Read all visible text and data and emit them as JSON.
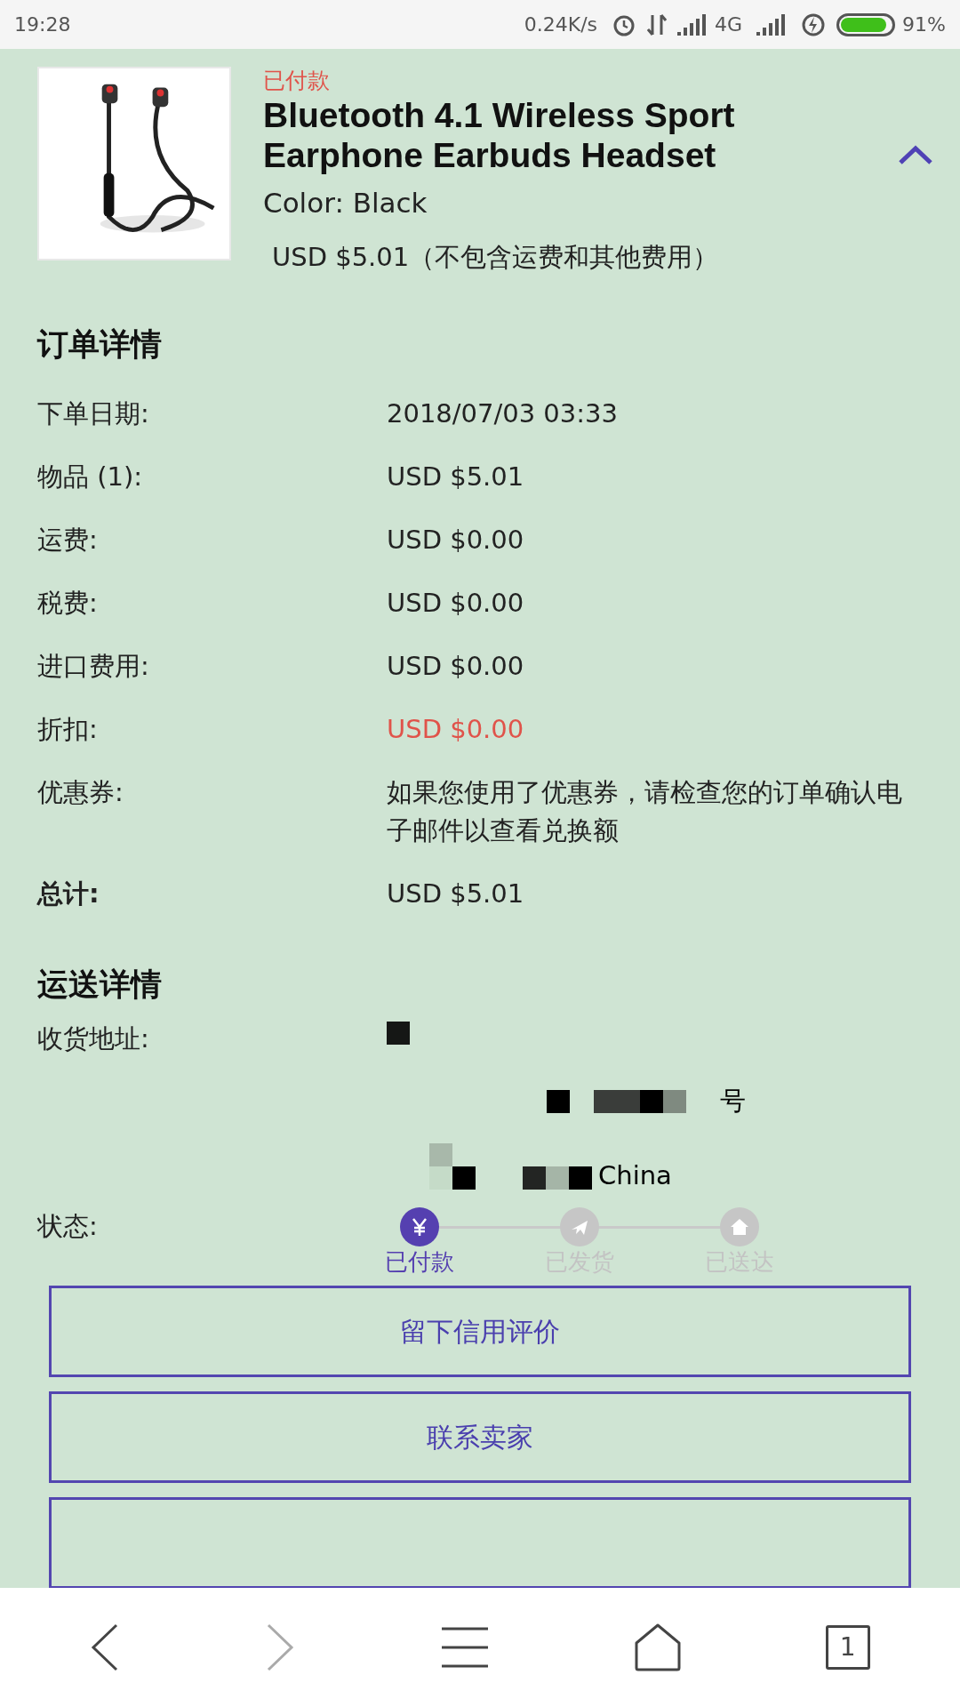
{
  "status_bar": {
    "time": "19:28",
    "speed": "0.24K/s",
    "network": "4G",
    "battery": "91%"
  },
  "item": {
    "status": "已付款",
    "title": "Bluetooth 4.1 Wireless Sport Earphone Earbuds Headset",
    "variant": "Color: Black",
    "price": "USD $5.01（不包含运费和其他费用）",
    "expanded": true
  },
  "order_details": {
    "heading": "订单详情",
    "rows": [
      {
        "label": "下单日期:",
        "value": "2018/07/03 03:33",
        "kind": "plain"
      },
      {
        "label": "物品 (1):",
        "value": "USD $5.01",
        "kind": "plain"
      },
      {
        "label": "运费:",
        "value": "USD $0.00",
        "kind": "plain"
      },
      {
        "label": "税费:",
        "value": "USD $0.00",
        "kind": "plain"
      },
      {
        "label": "进口费用:",
        "value": "USD $0.00",
        "kind": "plain"
      },
      {
        "label": "折扣:",
        "value": "USD $0.00",
        "kind": "discount"
      },
      {
        "label": "优惠券:",
        "value": "如果您使用了优惠券，请检查您的订单确认电子邮件以查看兑换额",
        "kind": "plain"
      },
      {
        "label": "总计:",
        "value": "USD $5.01",
        "kind": "total"
      }
    ]
  },
  "shipping": {
    "heading": "运送详情",
    "address_label": "收货地址:",
    "address_lines": [
      "号",
      "China"
    ],
    "status_label": "状态:",
    "steps": [
      {
        "label": "已付款",
        "kind": "paid",
        "done": true
      },
      {
        "label": "已发货",
        "kind": "shipped",
        "done": false
      },
      {
        "label": "已送达",
        "kind": "delivered",
        "done": false
      }
    ]
  },
  "buttons": [
    "留下信用评价",
    "联系卖家"
  ],
  "more_buttons_below": true,
  "nav": [
    {
      "kind": "back",
      "disabled": false
    },
    {
      "kind": "forward",
      "disabled": true
    },
    {
      "kind": "menu",
      "disabled": false
    },
    {
      "kind": "home",
      "disabled": false
    },
    {
      "kind": "tabs",
      "count": "1",
      "disabled": false
    }
  ]
}
